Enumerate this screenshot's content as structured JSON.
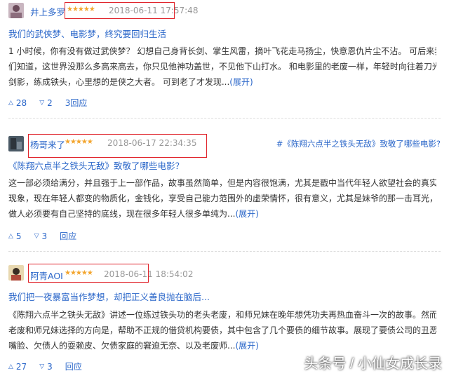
{
  "reviews": [
    {
      "user": "井上多罗",
      "stars": "★★★★★",
      "time": "2018-06-11 17:57:48",
      "title": "我们的武侠梦、电影梦，终究要回归生活",
      "tag": "",
      "lines": [
        "1 小时候，你有没有做过武侠梦？ 幻想自己身背长剑、掌生风雷，摘叶飞花走马扬尘，快意恩仇片尘不沾。 可后来我",
        "们知道，这世界没那么多高来高去，你只见他神功盖世，不见他下山打水。 和电影里的老废一样，年轻时向往着刀光",
        "剑影，练成铁头，心里想的是侠之大者。 可到老了才发现..."
      ],
      "more": "(展开)",
      "up": "28",
      "down": "2",
      "reply": "3回应"
    },
    {
      "user": "杨哥来了",
      "stars": "★★★★★",
      "time": "2018-06-17 22:34:35",
      "title": "《陈翔六点半之铁头无敌》致敬了哪些电影？",
      "tag": "#《陈翔六点半之铁头无敌》致敬了哪些电影?",
      "lines": [
        "这一部必须给满分，并且强于上一部作品，故事虽然简单，但是内容很饱满，尤其是戳中当代年轻人欲望社会的真实",
        "现象，现在年轻人都变的物质化，金钱化，享受自己能力范围外的虚荣情怀，很有意义，尤其是妹爷的那一击耳光，",
        "做人必须要有自己坚持的底线，现在很多年轻人很多单纯为..."
      ],
      "more": "(展开)",
      "up": "5",
      "down": "3",
      "reply": "回应"
    },
    {
      "user": "阿青AOI",
      "stars": "★★★★★",
      "time": "2018-06-11 18:54:02",
      "title": "我们把一夜暴富当作梦想，却把正义善良抛在脑后...",
      "tag": "",
      "lines": [
        "《陈翔六点半之铁头无敌》讲述一位练过铁头功的老头老废，和师兄妹在晚年想凭功夫再热血奋斗一次的故事。然而",
        "老废和师兄妹选择的方向是，帮助不正规的借贷机构要债，其中包含了几个要债的细节故事。展现了要债公司的丑恶",
        "嘴脸、欠债人的耍赖皮、欠债家庭的窘迫无奈、以及老废师..."
      ],
      "more": "(展开)",
      "up": "27",
      "down": "3",
      "reply": "回应"
    }
  ],
  "watermark": "头条号 / 小仙女成长录"
}
